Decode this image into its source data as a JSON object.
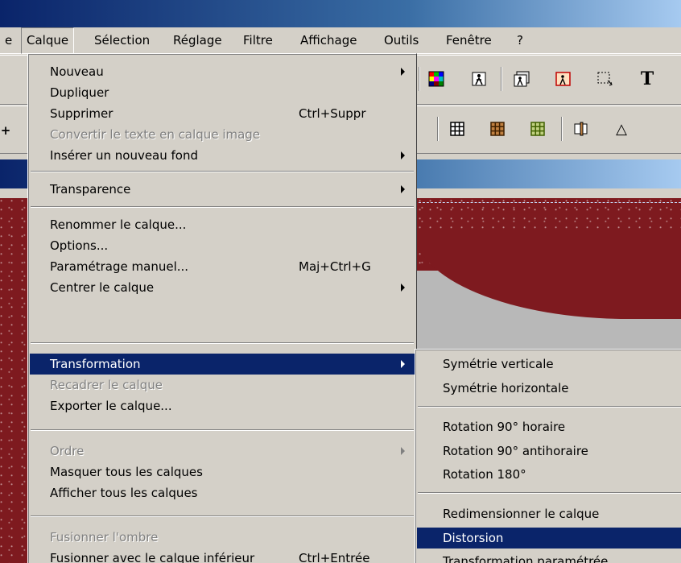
{
  "menubar": {
    "items": [
      {
        "label": "e",
        "active": false
      },
      {
        "label": "Calque",
        "active": true
      },
      {
        "label": "Sélection",
        "active": false
      },
      {
        "label": "Réglage",
        "active": false
      },
      {
        "label": "Filtre",
        "active": false
      },
      {
        "label": "Affichage",
        "active": false
      },
      {
        "label": "Outils",
        "active": false
      },
      {
        "label": "Fenêtre",
        "active": false
      },
      {
        "label": "?",
        "active": false
      }
    ]
  },
  "toolbar": {
    "text_tool_glyph": "T",
    "drop_glyph": "△",
    "plus_glyph": "+"
  },
  "calque_menu": {
    "items": [
      {
        "label": "Nouveau",
        "shortcut": "",
        "submenu": true
      },
      {
        "label": "Dupliquer",
        "shortcut": "",
        "submenu": false
      },
      {
        "label": "Supprimer",
        "shortcut": "Ctrl+Suppr",
        "submenu": false
      },
      {
        "label": "Convertir le texte en calque image",
        "shortcut": "",
        "submenu": false,
        "disabled": true
      },
      {
        "label": "Insérer un nouveau fond",
        "shortcut": "",
        "submenu": true
      },
      {
        "label": "Transparence",
        "shortcut": "",
        "submenu": true
      },
      {
        "label": "Renommer le calque...",
        "shortcut": "",
        "submenu": false
      },
      {
        "label": "Options...",
        "shortcut": "",
        "submenu": false
      },
      {
        "label": "Paramétrage manuel...",
        "shortcut": "Maj+Ctrl+G",
        "submenu": false
      },
      {
        "label": "Centrer le calque",
        "shortcut": "",
        "submenu": true
      },
      {
        "label": "Transformation",
        "shortcut": "",
        "submenu": true,
        "highlighted": true
      },
      {
        "label": "Recadrer le calque",
        "shortcut": "",
        "submenu": false,
        "disabled": true
      },
      {
        "label": "Exporter le calque...",
        "shortcut": "",
        "submenu": false
      },
      {
        "label": "Ordre",
        "shortcut": "",
        "submenu": true,
        "disabled": true
      },
      {
        "label": "Masquer tous les calques",
        "shortcut": "",
        "submenu": false
      },
      {
        "label": "Afficher tous les calques",
        "shortcut": "",
        "submenu": false
      },
      {
        "label": "Fusionner l'ombre",
        "shortcut": "",
        "submenu": false,
        "disabled": true
      },
      {
        "label": "Fusionner avec le calque inférieur",
        "shortcut": "Ctrl+Entrée",
        "submenu": false
      }
    ]
  },
  "transformation_submenu": {
    "items": [
      {
        "label": "Symétrie verticale"
      },
      {
        "label": "Symétrie horizontale"
      },
      {
        "label": "Rotation 90° horaire"
      },
      {
        "label": "Rotation 90° antihoraire"
      },
      {
        "label": "Rotation 180°"
      },
      {
        "label": "Redimensionner le calque"
      },
      {
        "label": "Distorsion",
        "highlighted": true
      },
      {
        "label": "Transformation paramétrée"
      }
    ]
  },
  "colors": {
    "highlight": "#0a246a",
    "face": "#d4d0c8",
    "canvas_red": "#7e1a1f",
    "disabled_text": "#808080"
  }
}
